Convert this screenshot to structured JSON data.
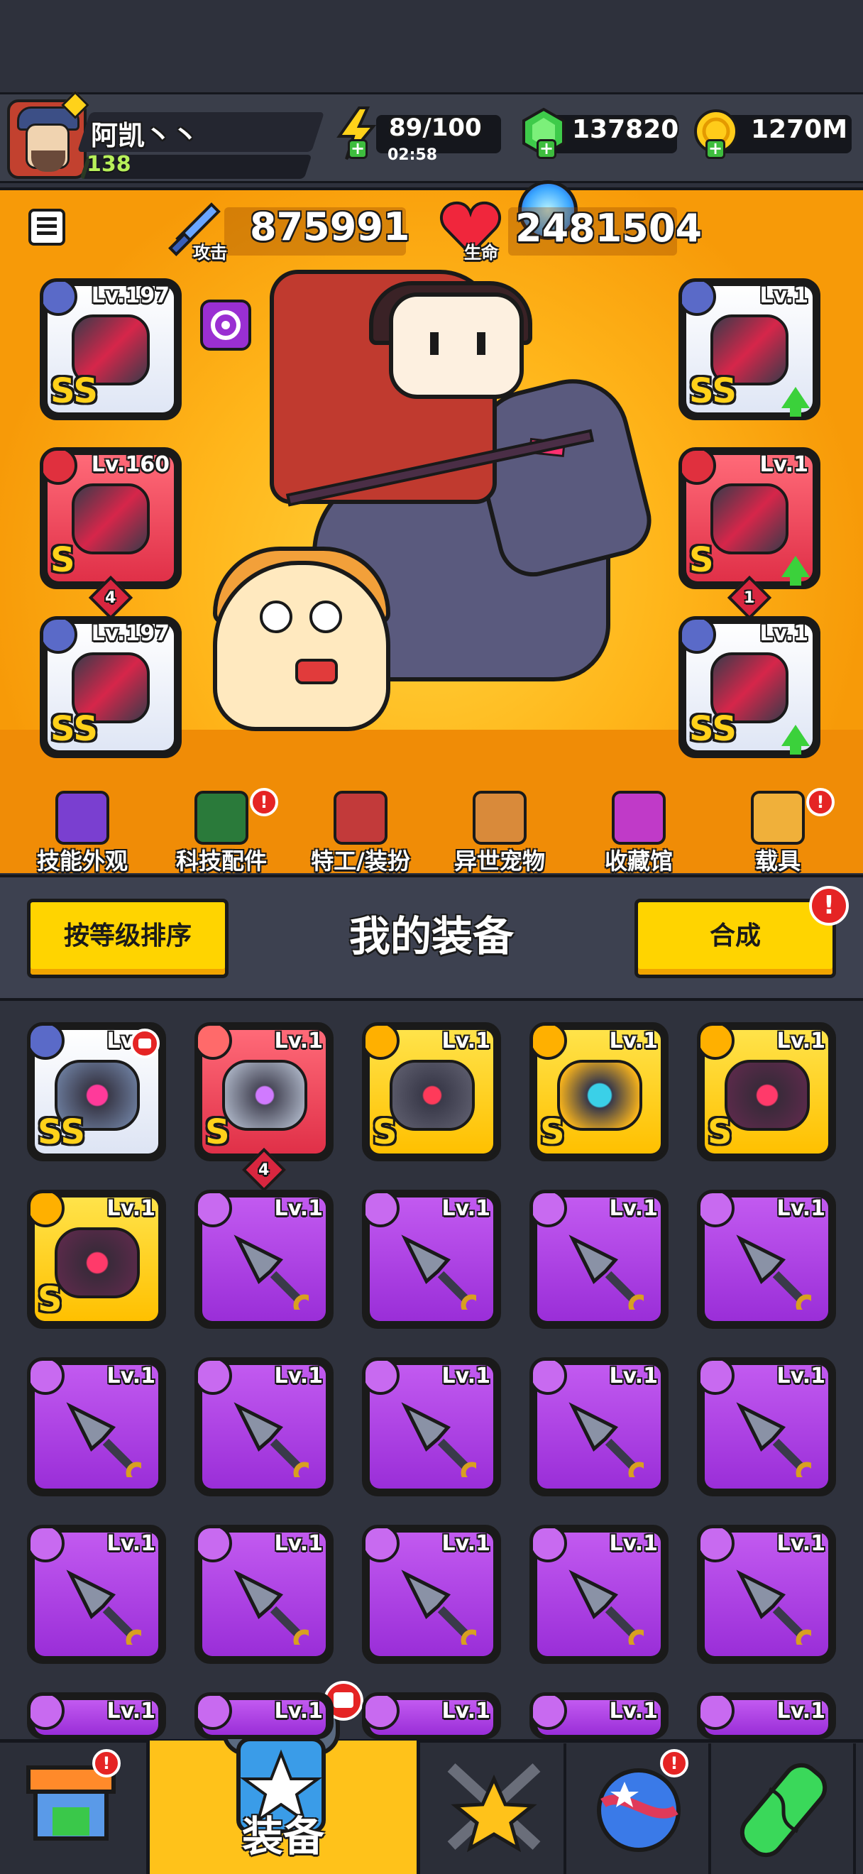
{
  "player": {
    "name": "阿凯丶丶",
    "level": "138",
    "level_progress": 0.02
  },
  "resources": {
    "energy": "89/100",
    "energy_timer": "02:58",
    "gems": "137820",
    "gold": "1270M"
  },
  "stats": {
    "attack_label": "攻击",
    "attack_value": "875991",
    "hp_label": "生命",
    "hp_value": "2481504"
  },
  "left_slots": [
    {
      "level": "Lv.197",
      "rarity": "SS",
      "icon": "dagger-badge-icon",
      "color": "#ffffff"
    },
    {
      "level": "Lv.160",
      "rarity": "S",
      "stars": "4",
      "icon": "necklace-badge-icon",
      "color": "#f04a58"
    },
    {
      "level": "Lv.197",
      "rarity": "SS",
      "icon": "glove-badge-icon",
      "color": "#ffffff"
    }
  ],
  "right_slots": [
    {
      "level": "Lv.1",
      "rarity": "SS",
      "icon": "armor-badge-icon",
      "color": "#ffffff",
      "upgrade": true
    },
    {
      "level": "Lv.1",
      "rarity": "S",
      "stars": "1",
      "icon": "belt-badge-icon",
      "color": "#f04a58",
      "upgrade": true
    },
    {
      "level": "Lv.1",
      "rarity": "SS",
      "icon": "boots-badge-icon",
      "color": "#ffffff",
      "upgrade": true
    }
  ],
  "tabs": [
    {
      "label": "技能外观",
      "icon": "skill-skin-icon",
      "alert": false
    },
    {
      "label": "科技配件",
      "icon": "tech-parts-icon",
      "alert": true
    },
    {
      "label": "特工/装扮",
      "icon": "agent-outfit-icon",
      "alert": false
    },
    {
      "label": "异世宠物",
      "icon": "pet-icon",
      "alert": false
    },
    {
      "label": "收藏馆",
      "icon": "collection-icon",
      "alert": false
    },
    {
      "label": "载具",
      "icon": "vehicle-icon",
      "alert": true
    }
  ],
  "equipment_header": {
    "sort_button": "按等级排序",
    "title": "我的装备",
    "merge_button": "合成",
    "merge_alert": "!"
  },
  "equipment": [
    {
      "level": "Lv.1",
      "rarity": "SS",
      "kind": "belt",
      "bg": "#ffffff"
    },
    {
      "level": "Lv.1",
      "rarity": "S",
      "kind": "armor",
      "bg": "#f04a58",
      "stars": "4"
    },
    {
      "level": "Lv.1",
      "rarity": "S",
      "kind": "armor-dark",
      "bg": "#ffd21a"
    },
    {
      "level": "Lv.1",
      "rarity": "S",
      "kind": "belt-gold",
      "bg": "#ffd21a"
    },
    {
      "level": "Lv.1",
      "rarity": "S",
      "kind": "belt-dark",
      "bg": "#ffd21a"
    },
    {
      "level": "Lv.1",
      "rarity": "S",
      "kind": "belt-dark",
      "bg": "#ffd21a"
    },
    {
      "level": "Lv.1",
      "kind": "kunai",
      "bg": "#b03ee6"
    },
    {
      "level": "Lv.1",
      "kind": "kunai",
      "bg": "#b03ee6"
    },
    {
      "level": "Lv.1",
      "kind": "kunai",
      "bg": "#b03ee6"
    },
    {
      "level": "Lv.1",
      "kind": "kunai",
      "bg": "#b03ee6"
    },
    {
      "level": "Lv.1",
      "kind": "kunai",
      "bg": "#b03ee6"
    },
    {
      "level": "Lv.1",
      "kind": "kunai",
      "bg": "#b03ee6"
    },
    {
      "level": "Lv.1",
      "kind": "kunai",
      "bg": "#b03ee6"
    },
    {
      "level": "Lv.1",
      "kind": "kunai",
      "bg": "#b03ee6"
    },
    {
      "level": "Lv.1",
      "kind": "kunai",
      "bg": "#b03ee6"
    },
    {
      "level": "Lv.1",
      "kind": "kunai",
      "bg": "#b03ee6"
    },
    {
      "level": "Lv.1",
      "kind": "kunai",
      "bg": "#b03ee6"
    },
    {
      "level": "Lv.1",
      "kind": "kunai",
      "bg": "#b03ee6"
    },
    {
      "level": "Lv.1",
      "kind": "kunai",
      "bg": "#b03ee6"
    },
    {
      "level": "Lv.1",
      "kind": "kunai",
      "bg": "#b03ee6"
    },
    {
      "level": "Lv.1",
      "kind": "kunai",
      "bg": "#b03ee6"
    },
    {
      "level": "Lv.1",
      "kind": "kunai",
      "bg": "#b03ee6"
    },
    {
      "level": "Lv.1",
      "kind": "kunai",
      "bg": "#b03ee6"
    },
    {
      "level": "Lv.1",
      "kind": "kunai",
      "bg": "#b03ee6"
    },
    {
      "level": "Lv.1",
      "kind": "kunai",
      "bg": "#b03ee6"
    }
  ],
  "bottom_nav": [
    {
      "id": "shop",
      "icon": "shop-icon",
      "alert": true
    },
    {
      "id": "equip",
      "label": "装备",
      "icon": "equipment-icon",
      "alert": true
    },
    {
      "id": "battle",
      "icon": "crossed-swords-star-icon",
      "alert": false
    },
    {
      "id": "planet",
      "icon": "planet-icon",
      "alert": true
    },
    {
      "id": "lab",
      "icon": "dna-capsule-icon",
      "alert": false
    }
  ],
  "colors": {
    "hero_bg": "#ffa70a",
    "purple_item": "#b03ee6",
    "gold_item": "#ffd21a",
    "red_item": "#f04a58",
    "button_yellow": "#ffd400"
  }
}
